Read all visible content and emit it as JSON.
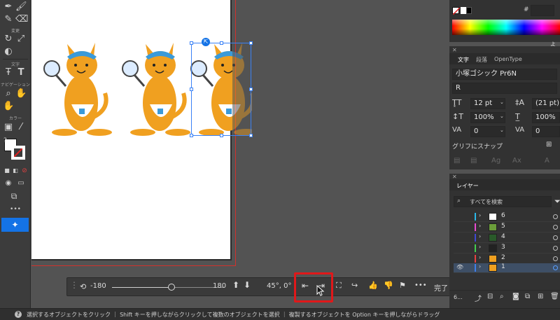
{
  "toolbar": {
    "sections": [
      "変更",
      "文字",
      "ナビゲーション",
      "カラー"
    ],
    "more": "•••",
    "tools": [
      "pen-icon",
      "brush-icon",
      "pencil-icon",
      "eraser-icon",
      "rotate-icon",
      "scale-icon",
      "shape-builder-icon",
      "free-transform-icon",
      "type-on-path-icon",
      "type-icon",
      "zoom-icon",
      "hand-icon",
      "rotate-view-icon",
      "gradient-icon",
      "eyedropper-icon",
      "fill-stroke-icon",
      "swap-icon",
      "default-colors-icon",
      "color-icon",
      "gradient-swatch-icon",
      "none-icon",
      "draw-mode-icon",
      "screen-mode-icon",
      "artboard-icon",
      "magic-icon"
    ]
  },
  "contextual_bar": {
    "rotate_min": "-180",
    "rotate_max": "180",
    "slider_value": 0,
    "angle": "45°, 0°",
    "done": "完了",
    "more": "•••"
  },
  "swatch_panel": {
    "hex_label": "#",
    "corner_text": "よく"
  },
  "char_panel": {
    "tabs": [
      "文字",
      "段落",
      "OpenType"
    ],
    "font_name": "小塚ゴシック Pr6N",
    "font_style": "R",
    "size": "12 pt",
    "leading": "(21 pt)",
    "vscale": "100%",
    "hscale": "100%",
    "kerning": "0",
    "tracking": "0",
    "snap_label": "グリフにスナップ"
  },
  "layers_panel": {
    "title": "レイヤー",
    "search_placeholder": "すべてを検索",
    "layers": [
      {
        "name": "6",
        "color": "#2ab8e8"
      },
      {
        "name": "5",
        "color": "#e84ad2"
      },
      {
        "name": "4",
        "color": "#3f49d4"
      },
      {
        "name": "3",
        "color": "#43d04f"
      },
      {
        "name": "2",
        "color": "#e84040"
      },
      {
        "name": "1",
        "color": "#3f7fe8"
      }
    ],
    "selected_layer": "1",
    "count": "6..."
  },
  "status_bar": {
    "text": "選択するオブジェクトをクリック ｜ Shift キーを押しながらクリックして複数のオブジェクトを選択 ｜ 複製するオブジェクトを Option キーを押しながらドラッグ"
  },
  "colors": {
    "accent": "#1473e6",
    "highlight": "#e0181a",
    "artboard_edge": "#d2312c",
    "kangaroo": "#f0a020",
    "hat": "#3a9ad9"
  }
}
